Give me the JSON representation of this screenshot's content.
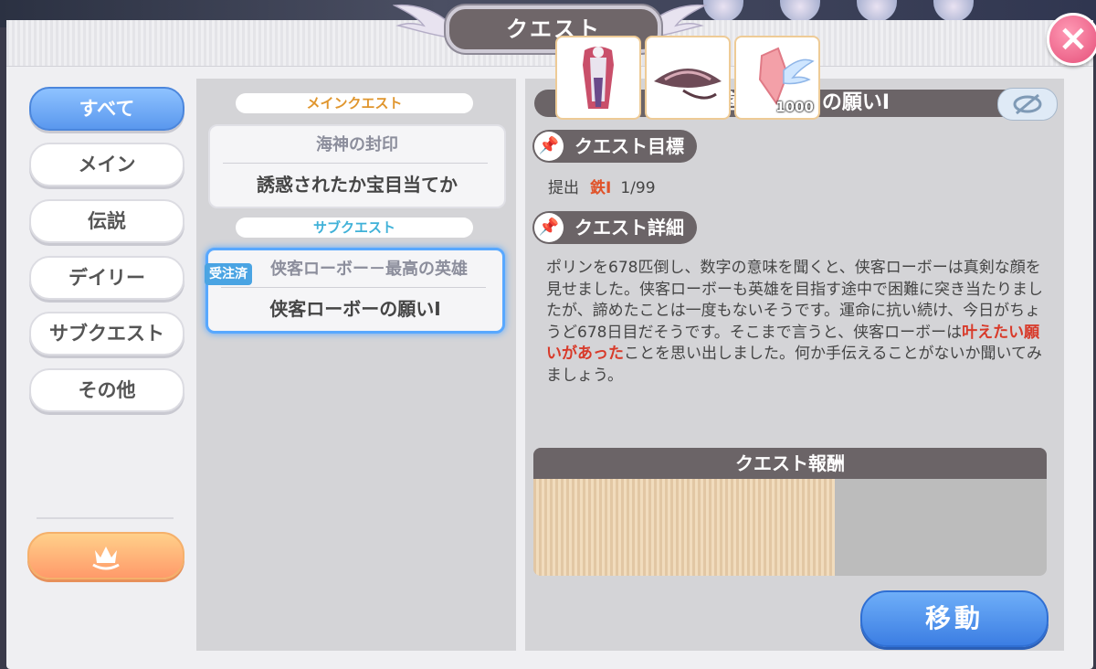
{
  "window": {
    "title": "クエスト"
  },
  "tabs": [
    {
      "label": "すべて",
      "active": true
    },
    {
      "label": "メイン"
    },
    {
      "label": "伝説"
    },
    {
      "label": "デイリー"
    },
    {
      "label": "サブクエスト"
    },
    {
      "label": "その他"
    }
  ],
  "quest_list": {
    "main_header": "メインクエスト",
    "main_card": {
      "chapter": "海神の封印",
      "name": "誘惑されたか宝目当てか"
    },
    "sub_header": "サブクエスト",
    "sub_card": {
      "badge": "受注済",
      "chapter": "侠客ローボー－最高の英雄",
      "name": "侠客ローボーの願いⅠ"
    }
  },
  "detail": {
    "title": "侠客ローボーの願いⅠ",
    "objective_label": "クエスト目標",
    "objective": {
      "verb": "提出",
      "item": "鉄Ⅰ",
      "progress": "1/99"
    },
    "detail_label": "クエスト詳細",
    "description": {
      "part1": "ポリンを678匹倒し、数字の意味を聞くと、侠客ローボーは真剣な顔を見せました。侠客ローボーも英雄を目指す途中で困難に突き当たりましたが、諦めたことは一度もないそうです。運命に抗い続け、今日がちょうど678日目だそうです。そこまで言うと、侠客ローボーは",
      "highlight": "叶えたい願いがあった",
      "part2": "ことを思い出しました。何か手伝えることがないか聞いてみましょう。"
    },
    "reward_label": "クエスト報酬",
    "rewards": [
      {
        "icon": "costume-icon"
      },
      {
        "icon": "straw-hat-icon"
      },
      {
        "icon": "winged-crystal-icon",
        "qty": "1000"
      }
    ]
  },
  "move_button": "移動",
  "colors": {
    "accent_blue": "#5a98ee",
    "highlight_red": "#d83a2a",
    "title_plate": "#6b6467"
  }
}
